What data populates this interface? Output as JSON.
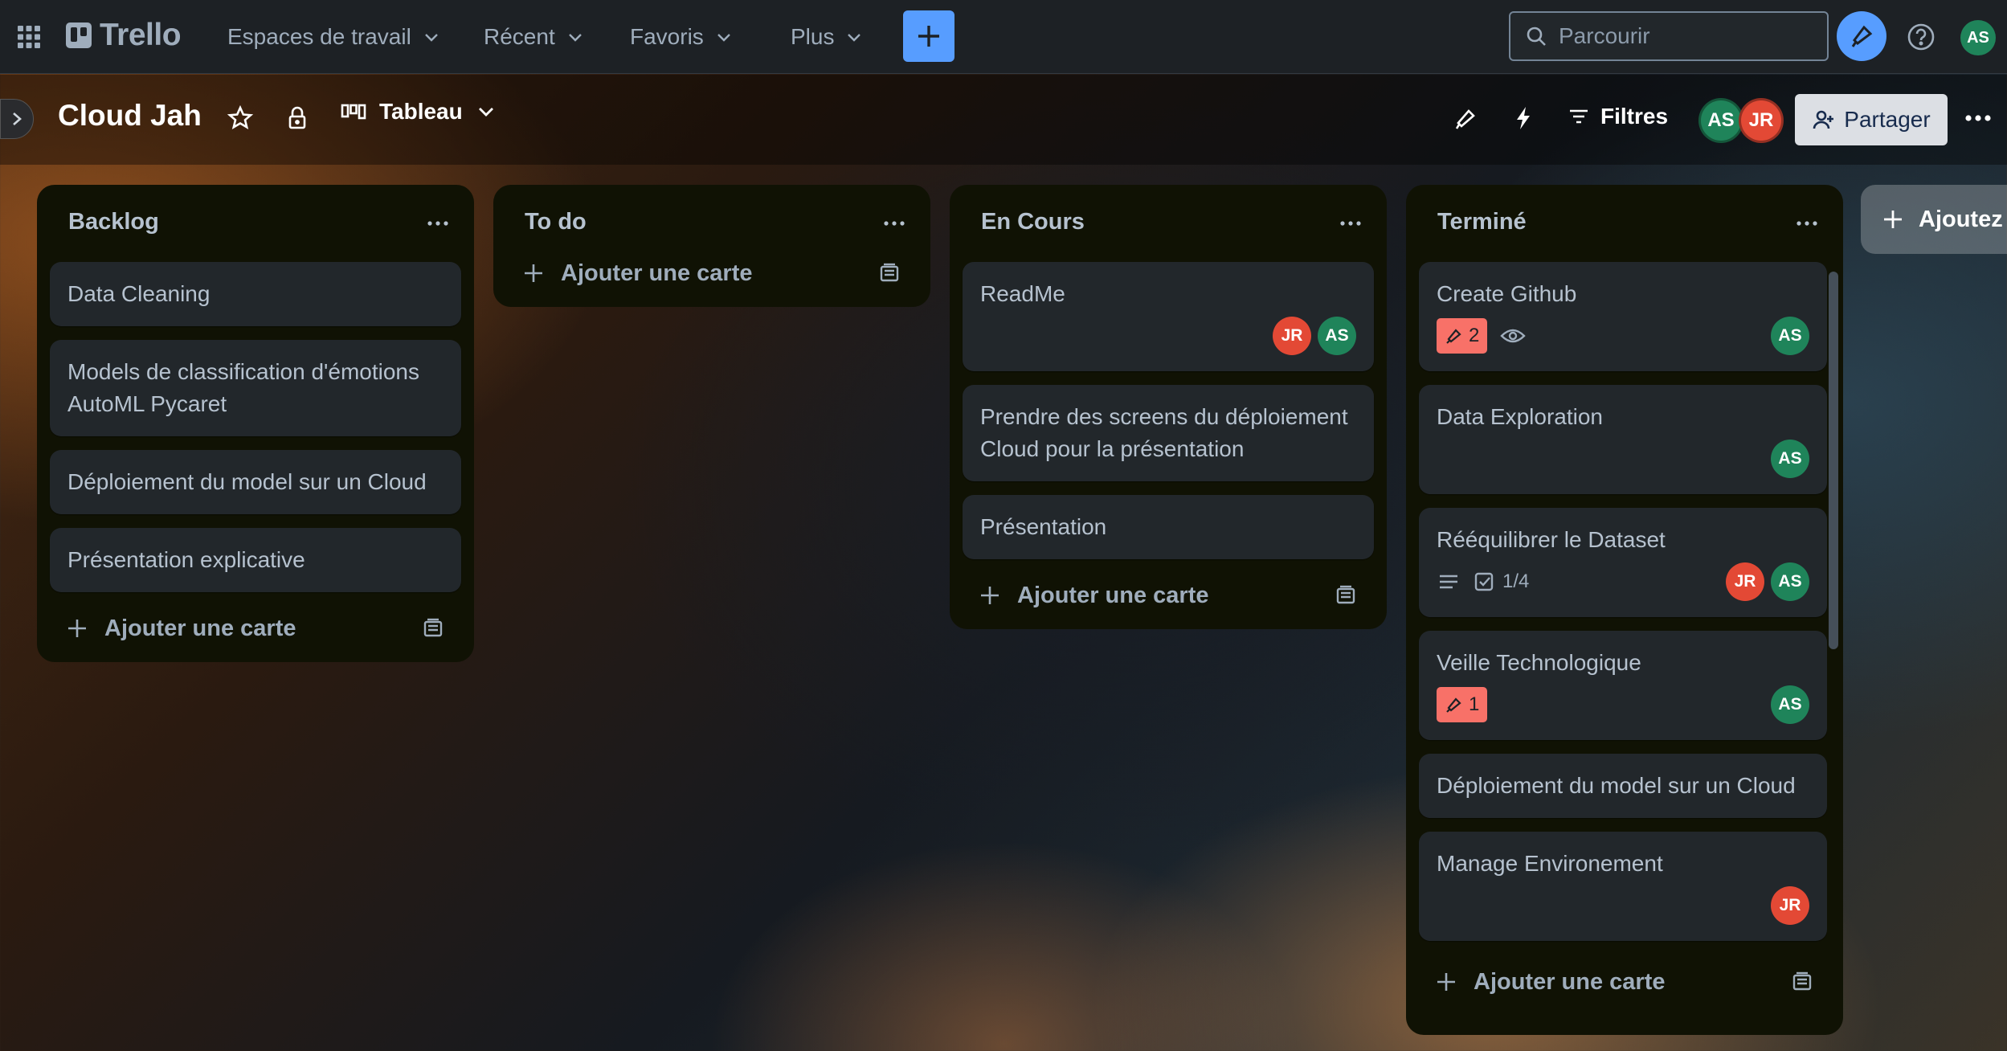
{
  "topnav": {
    "logo": "Trello",
    "menu": [
      {
        "label": "Espaces de travail"
      },
      {
        "label": "Récent"
      },
      {
        "label": "Favoris"
      },
      {
        "label": "Plus"
      }
    ],
    "search_placeholder": "Parcourir",
    "user_initials": "AS"
  },
  "board": {
    "title": "Cloud Jah",
    "view_label": "Tableau",
    "filters_label": "Filtres",
    "members": [
      "AS",
      "JR"
    ],
    "share_label": "Partager"
  },
  "lists": [
    {
      "title": "Backlog",
      "add_card": "Ajouter une carte",
      "cards": [
        {
          "title": "Data Cleaning"
        },
        {
          "title": "Models de classification d'émotions AutoML Pycaret"
        },
        {
          "title": "Déploiement du model sur un Cloud"
        },
        {
          "title": "Présentation explicative"
        }
      ]
    },
    {
      "title": "To do",
      "add_card": "Ajouter une carte",
      "cards": []
    },
    {
      "title": "En Cours",
      "add_card": "Ajouter une carte",
      "cards": [
        {
          "title": "ReadMe",
          "members": [
            "JR",
            "AS"
          ]
        },
        {
          "title": "Prendre des screens du déploiement Cloud pour la présentation"
        },
        {
          "title": "Présentation"
        }
      ]
    },
    {
      "title": "Terminé",
      "add_card": "Ajouter une carte",
      "cards": [
        {
          "title": "Create Github",
          "pin_count": "2",
          "watching": true,
          "members": [
            "AS"
          ]
        },
        {
          "title": "Data Exploration",
          "members": [
            "AS"
          ]
        },
        {
          "title": "Rééquilibrer le Dataset",
          "has_description": true,
          "checklist": "1/4",
          "members": [
            "JR",
            "AS"
          ]
        },
        {
          "title": "Veille Technologique",
          "pin_count": "1",
          "members": [
            "AS"
          ]
        },
        {
          "title": "Déploiement du model sur un Cloud"
        },
        {
          "title": "Manage Environement",
          "members": [
            "JR"
          ]
        }
      ]
    }
  ],
  "add_list_label": "Ajoutez",
  "colors": {
    "accent": "#579dff",
    "member_as": "#1f845a",
    "member_jr": "#e34935",
    "badge_pink": "#f87168"
  }
}
